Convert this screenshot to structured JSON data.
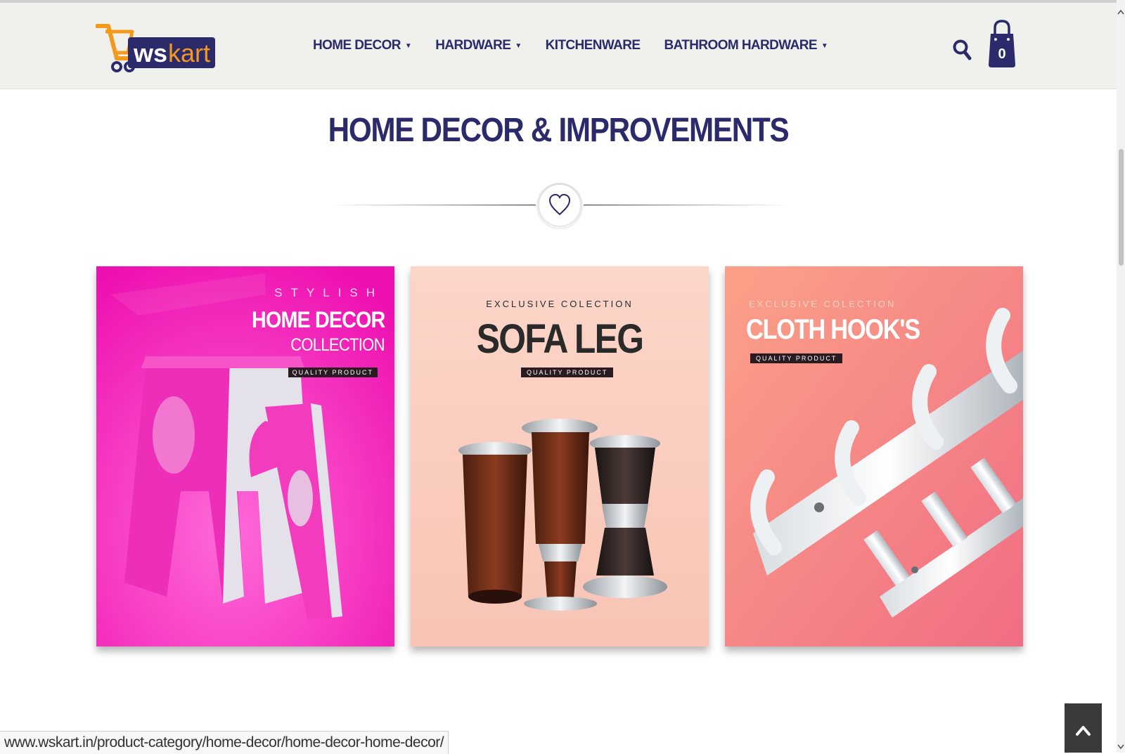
{
  "brand": {
    "name": "wskart",
    "prefix": "ws",
    "suffix": "kart"
  },
  "nav": [
    {
      "label": "HOME DECOR",
      "has_dropdown": true
    },
    {
      "label": "HARDWARE",
      "has_dropdown": true
    },
    {
      "label": "KITCHENWARE",
      "has_dropdown": false
    },
    {
      "label": "BATHROOM HARDWARE",
      "has_dropdown": true
    }
  ],
  "header": {
    "cart_count": "0",
    "search_icon": "search-icon",
    "cart_icon": "shopping-bag-icon"
  },
  "section": {
    "title": "HOME DECOR & IMPROVEMENTS",
    "divider_icon": "heart-icon"
  },
  "cards": [
    {
      "kicker": "STYLISH",
      "title": "HOME DECOR",
      "subtitle": "COLLECTION",
      "badge": "QUALITY PRODUCT",
      "bg": "#f116b5"
    },
    {
      "kicker": "EXCLUSIVE COLECTION",
      "title": "SOFA LEG",
      "badge": "QUALITY PRODUCT",
      "bg": "#fbd2c4"
    },
    {
      "kicker": "EXCLUSIVE COLECTION",
      "title": "CLOTH HOOK'S",
      "badge": "QUALITY PRODUCT",
      "bg": "#f58a86"
    }
  ],
  "status_bar": {
    "url": "www.wskart.in/product-category/home-decor/home-decor-home-decor/"
  },
  "to_top": {
    "icon": "chevron-up-icon"
  },
  "colors": {
    "brand": "#2b2a6b",
    "accent": "#f39a1d",
    "header_bg": "#f0f0ed"
  }
}
